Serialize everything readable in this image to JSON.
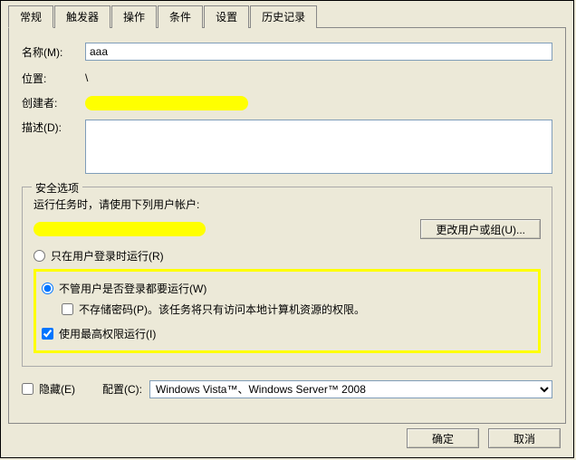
{
  "tabs": [
    "常规",
    "触发器",
    "操作",
    "条件",
    "设置",
    "历史记录"
  ],
  "activeTab": 0,
  "fields": {
    "nameLabel": "名称(M):",
    "nameValue": "aaa",
    "locationLabel": "位置:",
    "locationValue": "\\",
    "authorLabel": "创建者:",
    "descLabel": "描述(D):",
    "descValue": ""
  },
  "security": {
    "legend": "安全选项",
    "prompt": "运行任务时，请使用下列用户帐户:",
    "changeBtn": "更改用户或组(U)...",
    "radioOnlyLogged": "只在用户登录时运行(R)",
    "radioAlways": "不管用户是否登录都要运行(W)",
    "checkNoPassword": "不存储密码(P)。该任务将只有访问本地计算机资源的权限。",
    "checkHighest": "使用最高权限运行(I)",
    "checkNoPasswordChecked": false,
    "checkHighestChecked": true,
    "radioSelected": "always"
  },
  "bottom": {
    "hiddenLabel": "隐藏(E)",
    "hiddenChecked": false,
    "configLabel": "配置(C):",
    "configValue": "Windows Vista™、Windows Server™ 2008"
  },
  "buttons": {
    "ok": "确定",
    "cancel": "取消"
  }
}
